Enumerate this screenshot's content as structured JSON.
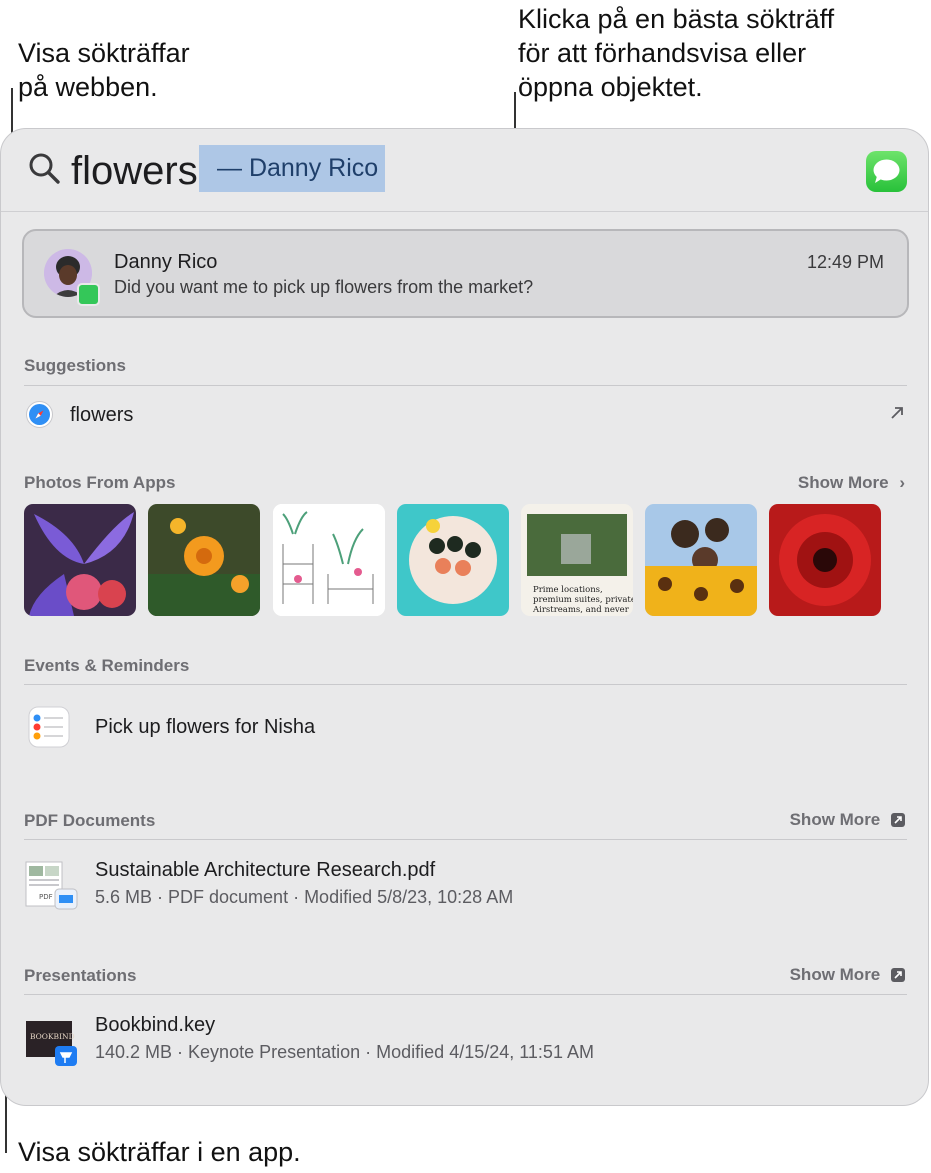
{
  "callouts": {
    "web": [
      "Visa sökträffar",
      "på webben."
    ],
    "tophit": [
      "Klicka på en bästa sökträff",
      "för att förhandsvisa eller",
      "öppna objektet."
    ],
    "app": "Visa sökträffar i en app."
  },
  "search": {
    "query": "flowers",
    "completion": "— Danny Rico"
  },
  "top_hit": {
    "name": "Danny Rico",
    "message": "Did you want me to pick up flowers from the market?",
    "time": "12:49 PM"
  },
  "suggestions": {
    "header": "Suggestions",
    "item": "flowers"
  },
  "photos": {
    "header": "Photos From Apps",
    "show_more": "Show More",
    "thumbs": [
      "iris-flowers-photo",
      "orange-marigold-photo",
      "plant-shelf-drawing",
      "sushi-plate-photo",
      "magazine-page-photo",
      "sunflowers-people-photo",
      "red-gerbera-photo"
    ],
    "magazine_text": [
      "Prime locations,",
      "premium suites, private",
      "Airstreams, and never"
    ]
  },
  "events": {
    "header": "Events & Reminders",
    "item": "Pick up flowers for Nisha"
  },
  "pdf": {
    "header": "PDF Documents",
    "show_more": "Show More",
    "title": "Sustainable Architecture Research.pdf",
    "meta": "5.6 MB · PDF document · Modified 5/8/23, 10:28 AM",
    "icon_label": "PDF"
  },
  "presentations": {
    "header": "Presentations",
    "show_more": "Show More",
    "title": "Bookbind.key",
    "meta": "140.2 MB · Keynote Presentation · Modified 4/15/24, 11:51 AM",
    "icon_label": "BOOKBIND"
  },
  "colors": {
    "completion_highlight": "#aec7e6",
    "messages_green": "#34c759",
    "panel_bg": "#e9e9ea"
  }
}
